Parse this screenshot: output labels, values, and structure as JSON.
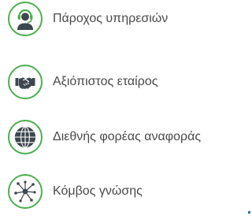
{
  "items": [
    {
      "label": "Πάροχος υπηρεσιών",
      "icon": "customer-service-agent-icon"
    },
    {
      "label": "Αξιόπιστος εταίρος",
      "icon": "handshake-icon"
    },
    {
      "label": "Διεθνής φορέας αναφοράς",
      "icon": "globe-icon"
    },
    {
      "label": "Κόμβος γνώσης",
      "icon": "network-hub-icon"
    }
  ],
  "colors": {
    "accent_green": "#4caf50",
    "icon_dark": "#3d4750",
    "text": "#4a4a4a",
    "marker_blue": "#1e6fb5"
  }
}
